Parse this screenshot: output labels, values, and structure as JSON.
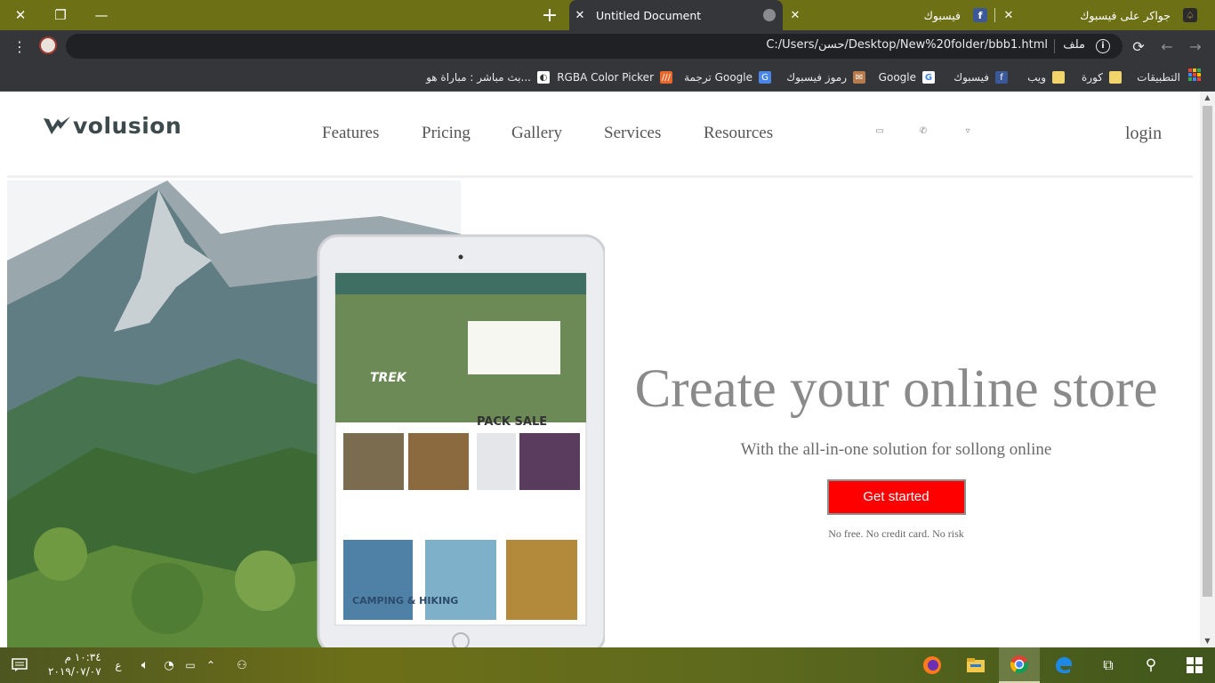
{
  "browser": {
    "tabs": [
      {
        "title": "Untitled Document",
        "active": true
      },
      {
        "title": "فيسبوك",
        "active": false
      },
      {
        "title": "جواكر على فيسبوك",
        "active": false
      }
    ],
    "address": {
      "url": "C:/Users/حسن/Desktop/New%20folder/bbb1.html",
      "scheme_label": "ملف"
    },
    "bookmarks": [
      {
        "label": "التطبيقات",
        "icon": "apps-grid-icon"
      },
      {
        "label": "كورة",
        "icon": "folder-icon"
      },
      {
        "label": "ويب",
        "icon": "folder-icon"
      },
      {
        "label": "فيسبوك",
        "icon": "facebook-icon"
      },
      {
        "label": "Google",
        "icon": "google-icon"
      },
      {
        "label": "رموز فيسبوك",
        "icon": "bookmark-favicon"
      },
      {
        "label": "ترجمة Google",
        "icon": "google-translate-icon"
      },
      {
        "label": "RGBA Color Picker",
        "icon": "color-picker-icon"
      },
      {
        "label": "بث مباشر : مباراة هو...",
        "icon": "live-stream-icon"
      }
    ]
  },
  "site": {
    "logo": "volusion",
    "nav": [
      "Features",
      "Pricing",
      "Gallery",
      "Services",
      "Resources"
    ],
    "header_icons": [
      "chat-icon",
      "phone-icon",
      "cart-icon"
    ],
    "login": "login",
    "hero": {
      "title": "Create your online store",
      "subtitle": "With the all-in-one solution for sollong online",
      "cta": "Get started",
      "note": "No free. No credit card. No risk"
    },
    "tablet": {
      "brand": "TREK",
      "banner": "PACK SALE",
      "section": "CAMPING & HIKING"
    }
  },
  "taskbar": {
    "time": "١٠:٣٤ م",
    "date": "٢٠١٩/٠٧/٠٧",
    "lang": "ع"
  },
  "colors": {
    "titlebar": "#6e7016",
    "toolbar": "#35363a",
    "cta": "#fe0000"
  }
}
